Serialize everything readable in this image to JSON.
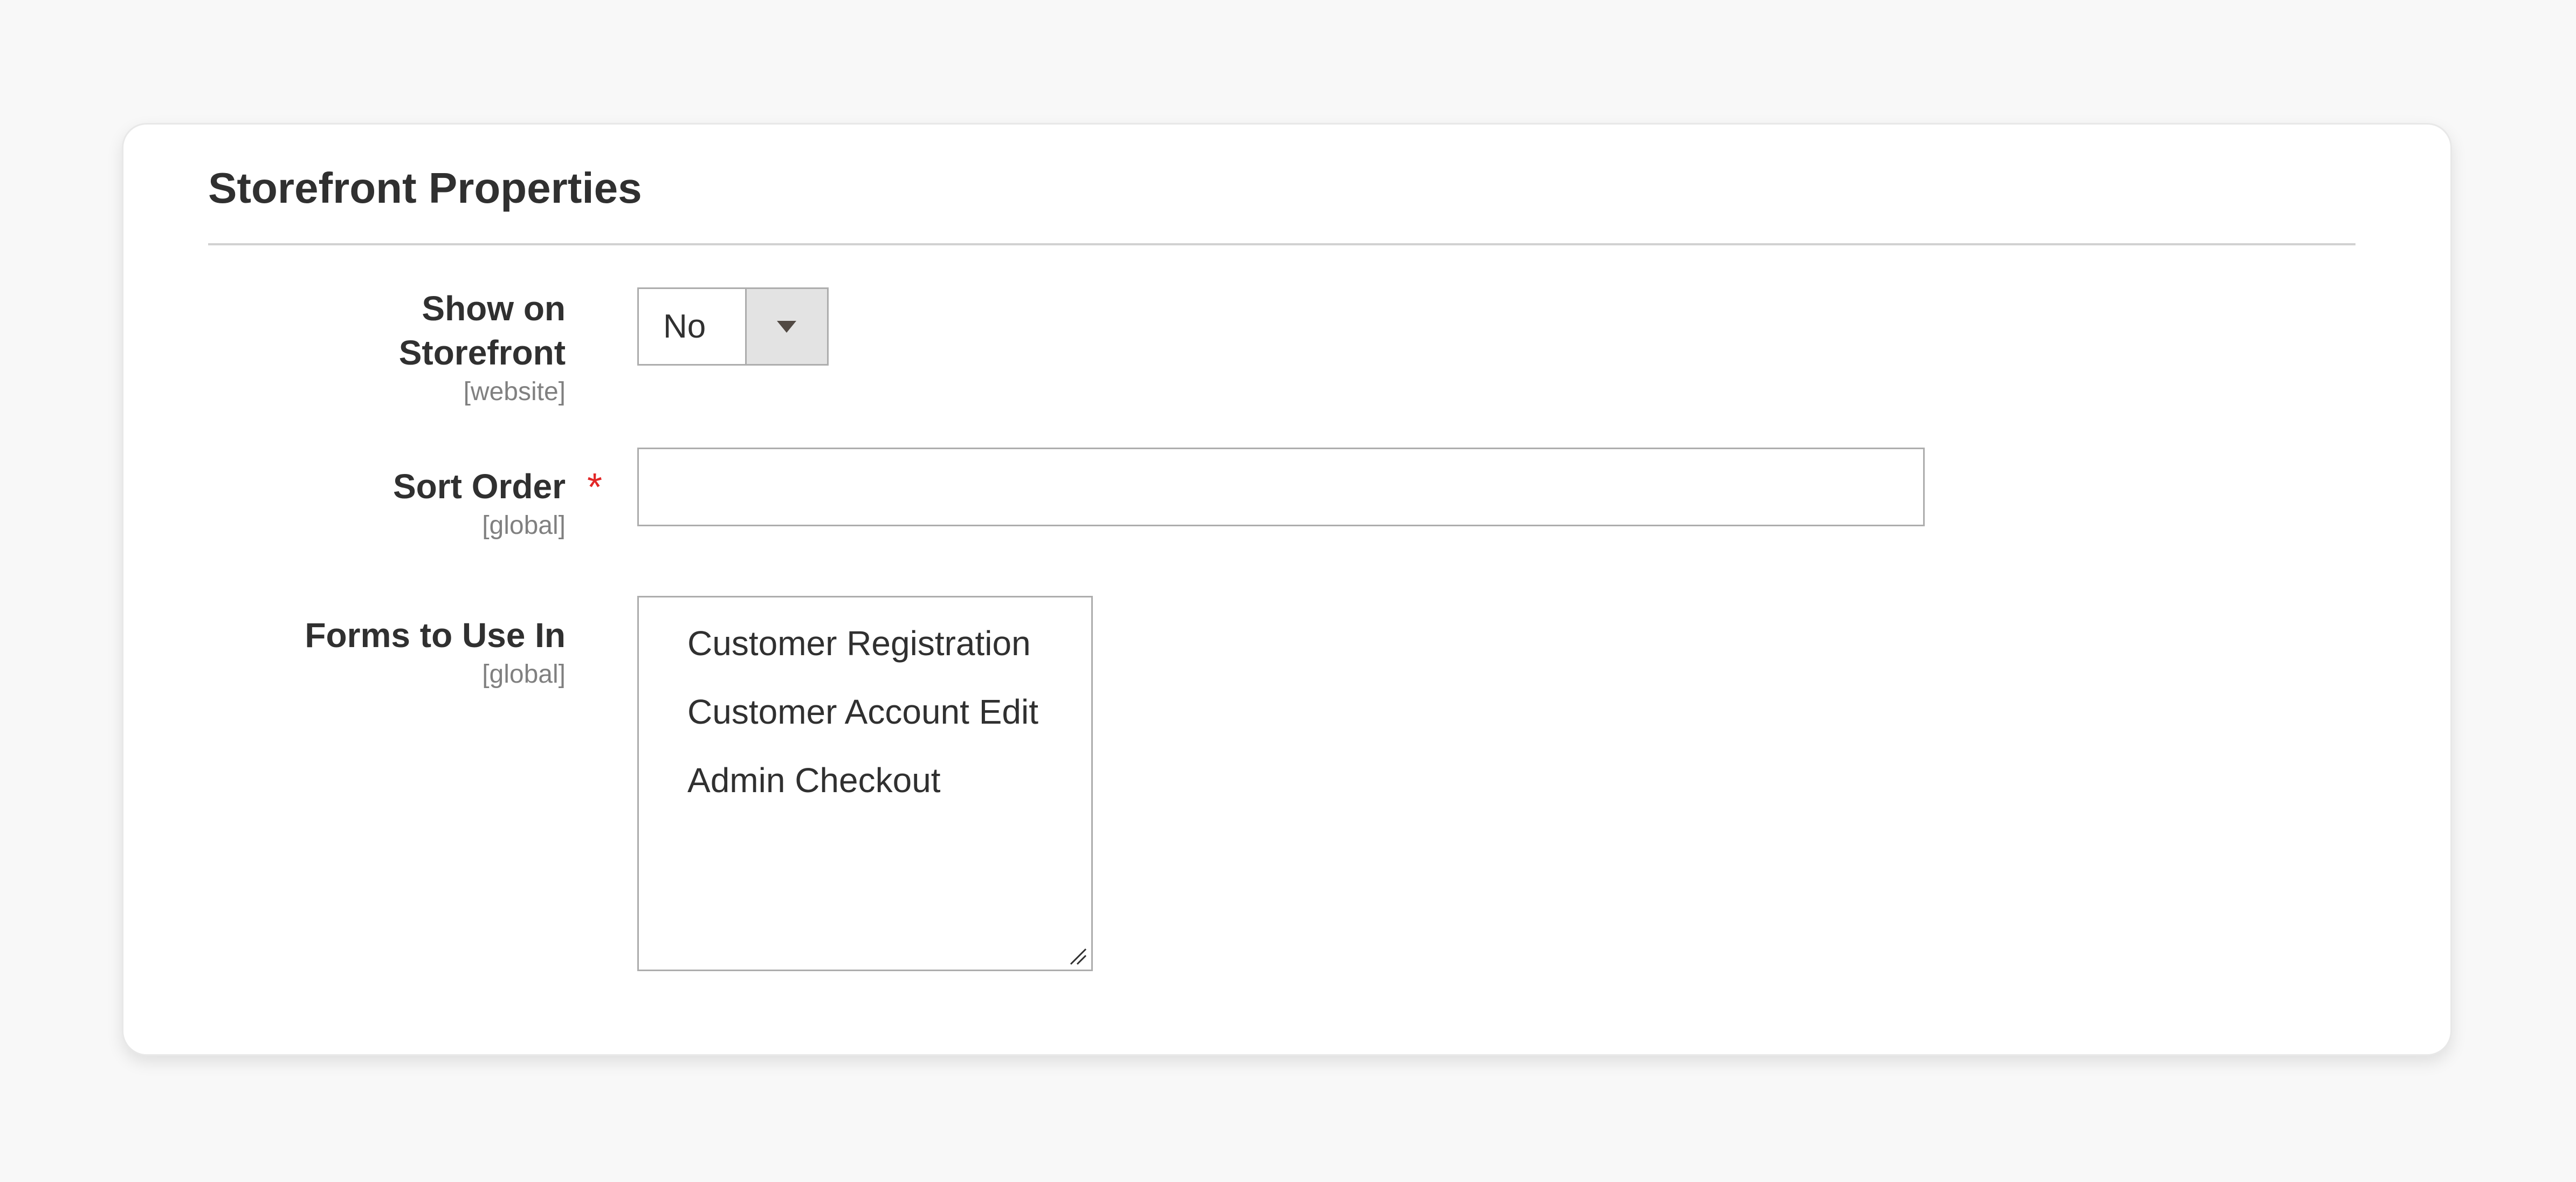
{
  "section": {
    "title": "Storefront Properties"
  },
  "fields": {
    "show_on_storefront": {
      "label_line1": "Show on",
      "label_line2": "Storefront",
      "scope": "[website]",
      "value": "No"
    },
    "sort_order": {
      "label": "Sort Order",
      "required_mark": "*",
      "scope": "[global]",
      "value": "",
      "placeholder": ""
    },
    "forms_to_use_in": {
      "label": "Forms to Use In",
      "scope": "[global]",
      "options": [
        "Customer Registration",
        "Customer Account Edit",
        "Admin Checkout"
      ]
    }
  },
  "icons": {
    "select_arrow": "chevron-down-icon",
    "resize": "resize-handle-icon"
  },
  "colors": {
    "required": "#e22626",
    "page_background": "#f8f8f8",
    "card_background": "#ffffff",
    "select_button": "#e3e3e3"
  }
}
